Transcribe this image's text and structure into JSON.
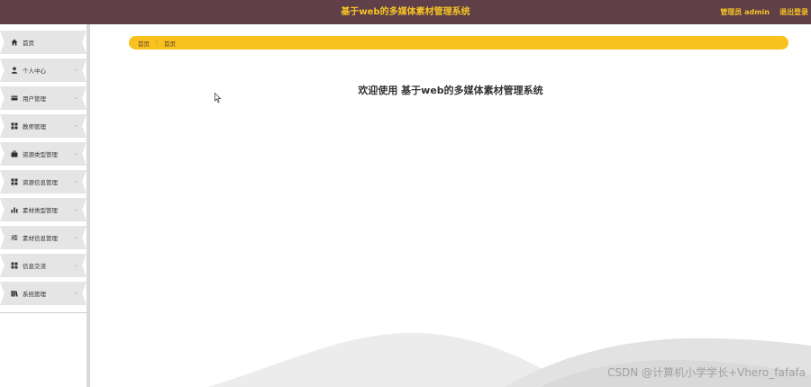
{
  "header": {
    "title": "基于web的多媒体素材管理系统",
    "user": "管理员 admin",
    "logout": "退出登录",
    "bg_color": "#5f4049",
    "accent_color": "#f7c424"
  },
  "sidebar": {
    "items": [
      {
        "label": "首页",
        "icon": "home-icon",
        "has_chevron": false
      },
      {
        "label": "个人中心",
        "icon": "user-icon",
        "has_chevron": true
      },
      {
        "label": "用户管理",
        "icon": "card-icon",
        "has_chevron": true
      },
      {
        "label": "教师管理",
        "icon": "grid-icon",
        "has_chevron": true
      },
      {
        "label": "资源类型管理",
        "icon": "briefcase-icon",
        "has_chevron": true
      },
      {
        "label": "资源信息管理",
        "icon": "grid-icon",
        "has_chevron": true
      },
      {
        "label": "素材类型管理",
        "icon": "bar-chart-icon",
        "has_chevron": true
      },
      {
        "label": "素材信息管理",
        "icon": "sliders-icon",
        "has_chevron": true
      },
      {
        "label": "信息交流",
        "icon": "grid-icon",
        "has_chevron": true
      },
      {
        "label": "系统管理",
        "icon": "book-icon",
        "has_chevron": true
      }
    ]
  },
  "breadcrumb": {
    "home": "首页",
    "separator": "⋮",
    "current": "首页",
    "color": "#f8c11d"
  },
  "main": {
    "welcome": "欢迎使用 基于web的多媒体素材管理系统"
  },
  "watermark": "CSDN @计算机小学学长+Vhero_fafafa"
}
